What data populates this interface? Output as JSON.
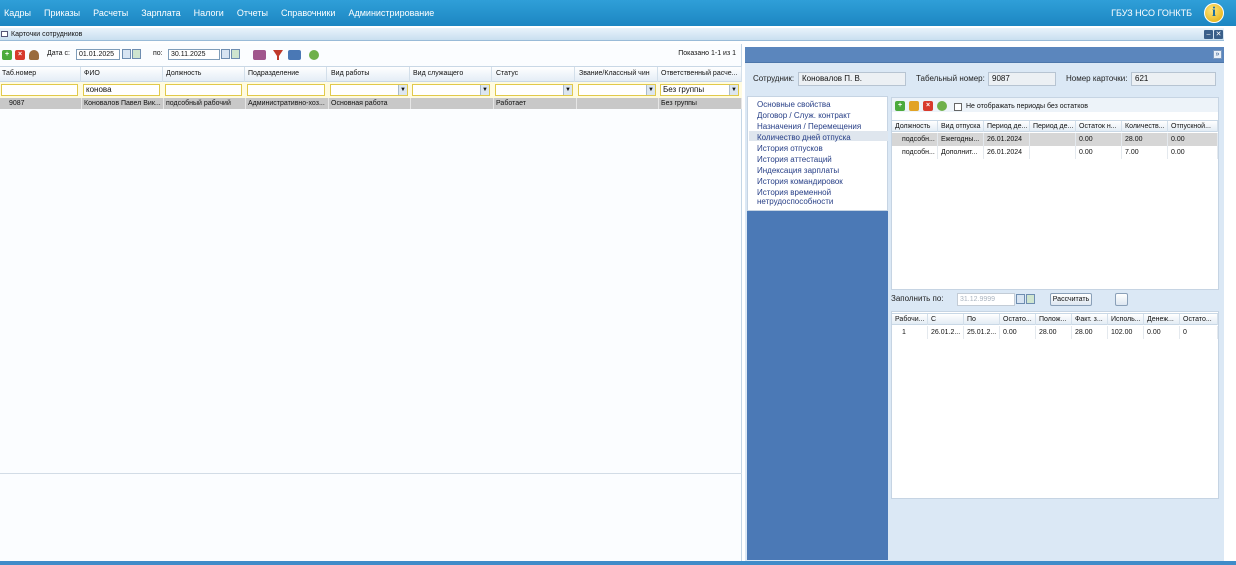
{
  "menu": [
    "Кадры",
    "Приказы",
    "Расчеты",
    "Зарплата",
    "Налоги",
    "Отчеты",
    "Справочники",
    "Администрирование"
  ],
  "org": "ГБУЗ НСО ГОНКТБ",
  "info_glyph": "i",
  "window": {
    "title": "Карточки сотрудников",
    "min": "–",
    "close": "✕"
  },
  "toolbar": {
    "date_from_label": "Дата с:",
    "date_from": "01.01.2025",
    "date_to_label": "по:",
    "date_to": "30.11.2025",
    "shown": "Показано 1-1 из 1"
  },
  "columns": [
    "Таб.номер",
    "ФИО",
    "Должность",
    "Подразделение",
    "Вид работы",
    "Вид служащего",
    "Статус",
    "Звание/Классный чин",
    "Ответственный расче..."
  ],
  "filters": {
    "fio": "конова",
    "responsible": "Без группы"
  },
  "row": [
    "9087",
    "Коновалов Павел Вик...",
    "подсобный рабочий",
    "Административно-хоз...",
    "Основная работа",
    "",
    "Работает",
    "",
    "Без группы"
  ],
  "right": {
    "collapse": "»",
    "employee_label": "Сотрудник:",
    "employee": "Коновалов П. В.",
    "tab_label": "Табельный номер:",
    "tab": "9087",
    "card_label": "Номер карточки:",
    "card": "621",
    "nav": [
      "Основные свойства",
      "Договор / Служ. контракт",
      "Назначения / Перемещения",
      "Количество дней отпуска",
      "История отпусков",
      "История аттестаций",
      "Индексация зарплаты",
      "История командировок",
      "История временной нетрудоспособности"
    ],
    "checkbox_label": "Не отображать периоды без остатков",
    "vac_columns": [
      "Должность",
      "Вид отпуска",
      "Период де...",
      "Период де...",
      "Остаток н...",
      "Количеств...",
      "Отпускной..."
    ],
    "vac_rows": [
      [
        "подсобн...",
        "Ежегодны...",
        "26.01.2024",
        "",
        "0.00",
        "28.00",
        "0.00"
      ],
      [
        "подсобн...",
        "Дополнит...",
        "26.01.2024",
        "",
        "0.00",
        "7.00",
        "0.00"
      ]
    ],
    "fill_label": "Заполнить по:",
    "fill_date": "31.12.9999",
    "calc": "Рассчитать",
    "res_columns": [
      "Рабочи...",
      "С",
      "По",
      "Остато...",
      "Полож...",
      "Факт. з...",
      "Исполь...",
      "Денеж...",
      "Остато..."
    ],
    "res_rows": [
      [
        "1",
        "26.01.2...",
        "25.01.2...",
        "0.00",
        "28.00",
        "28.00",
        "102.00",
        "0.00",
        "0"
      ]
    ]
  },
  "colors": {
    "topbar": "#1c86c2",
    "nav": "#4b79b6",
    "selected_row": "#c8c8c8",
    "filter_bg": "#fffbe0"
  },
  "icons": [
    "add-icon",
    "delete-icon",
    "user-icon",
    "calendar-icon",
    "settings-dropdown-icon",
    "filter-clear-icon",
    "print-icon",
    "refresh-icon",
    "edit-icon",
    "info-icon"
  ]
}
